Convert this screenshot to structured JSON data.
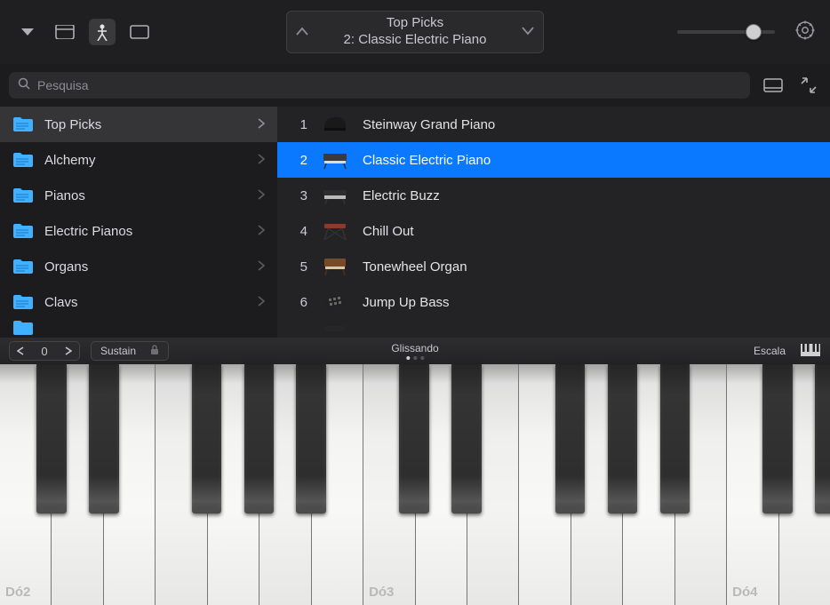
{
  "toolbar": {
    "track_title": "Top Picks",
    "track_subtitle": "2: Classic Electric Piano"
  },
  "search": {
    "placeholder": "Pesquisa"
  },
  "categories": [
    {
      "label": "Top Picks",
      "selected": true
    },
    {
      "label": "Alchemy"
    },
    {
      "label": "Pianos"
    },
    {
      "label": "Electric Pianos"
    },
    {
      "label": "Organs"
    },
    {
      "label": "Clavs"
    }
  ],
  "instruments": [
    {
      "index": "1",
      "name": "Steinway Grand Piano"
    },
    {
      "index": "2",
      "name": "Classic Electric Piano",
      "selected": true
    },
    {
      "index": "3",
      "name": "Electric Buzz"
    },
    {
      "index": "4",
      "name": "Chill Out"
    },
    {
      "index": "5",
      "name": "Tonewheel Organ"
    },
    {
      "index": "6",
      "name": "Jump Up Bass"
    }
  ],
  "keyboard_strip": {
    "octave_value": "0",
    "sustain_label": "Sustain",
    "mode_label": "Glissando",
    "scale_label": "Escala"
  },
  "keyboard": {
    "labels": {
      "k0": "Dó2",
      "k7": "Dó3",
      "k14": "Dó4"
    }
  },
  "colors": {
    "accent": "#0a79ff",
    "folder": "#41b0ff"
  }
}
